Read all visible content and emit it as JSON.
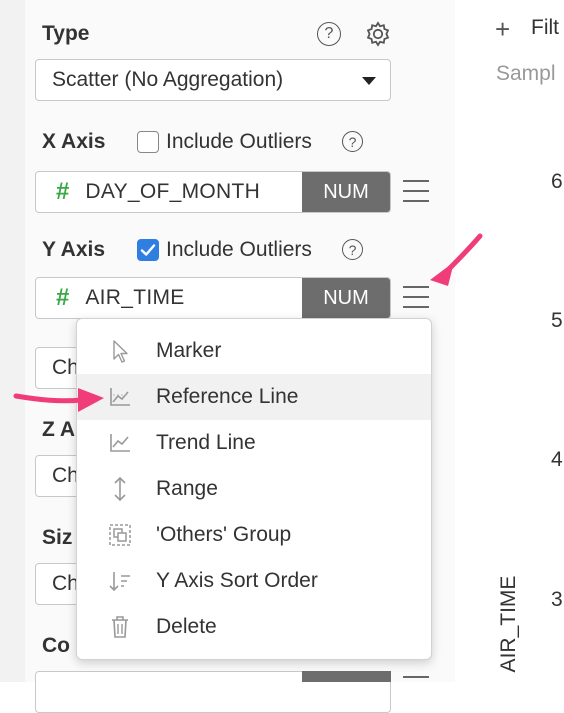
{
  "type_section": {
    "label": "Type",
    "help_icon": "help-circle-icon",
    "settings_icon": "gear-icon",
    "chart_type_value": "Scatter (No Aggregation)"
  },
  "x_axis": {
    "label": "X Axis",
    "include_outliers_label": "Include Outliers",
    "include_outliers_checked": false,
    "field_icon": "#",
    "field_name": "DAY_OF_MONTH",
    "field_type": "NUM"
  },
  "y_axis": {
    "label": "Y Axis",
    "include_outliers_label": "Include Outliers",
    "include_outliers_checked": true,
    "field_icon": "#",
    "field_name": "AIR_TIME",
    "field_type": "NUM"
  },
  "partial_labels": {
    "color_select_peek": "Ch",
    "z_axis_label_peek": "Z A",
    "z_select_peek": "Ch",
    "size_label_peek": "Siz",
    "size_select_peek": "Ch",
    "color_label_peek": "Co"
  },
  "context_menu": {
    "items": [
      {
        "label": "Marker",
        "icon": "cursor-icon"
      },
      {
        "label": "Reference Line",
        "icon": "line-chart-icon"
      },
      {
        "label": "Trend Line",
        "icon": "trend-chart-icon"
      },
      {
        "label": "Range",
        "icon": "vertical-range-icon"
      },
      {
        "label": "'Others' Group",
        "icon": "group-icon"
      },
      {
        "label": "Y Axis Sort Order",
        "icon": "sort-icon"
      },
      {
        "label": "Delete",
        "icon": "trash-icon"
      }
    ],
    "hovered_item": "Reference Line"
  },
  "right_panel": {
    "filter_icon": "+",
    "filter_label": "Filt",
    "sample_label": "Sampl",
    "y_ticks": [
      "6",
      "5",
      "4",
      "3"
    ],
    "y_axis_title": "AIR_TIME"
  },
  "annotations": {
    "arrow_color": "#f03c78"
  },
  "colors": {
    "accent": "#2f7fe3",
    "num_badge": "#6d6d6d",
    "hash_green": "#3aa845"
  }
}
